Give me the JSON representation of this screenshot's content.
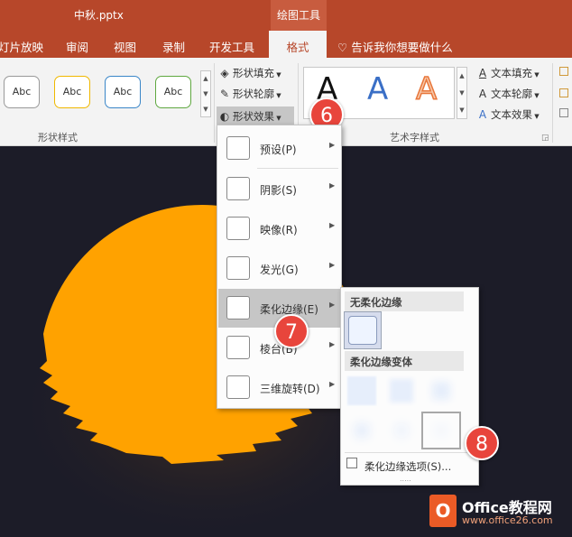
{
  "titlebar": {
    "file_title": "中秋.pptx",
    "context_tab": "绘图工具"
  },
  "tabs": {
    "slideshow": "灯片放映",
    "review": "审阅",
    "view": "视图",
    "record": "录制",
    "developer": "开发工具",
    "format": "格式",
    "tellme": "告诉我你想要做什么"
  },
  "ribbon": {
    "shape_styles": {
      "items": [
        "Abc",
        "Abc",
        "Abc",
        "Abc"
      ],
      "label": "形状样式"
    },
    "shape_cmds": {
      "fill": "形状填充",
      "outline": "形状轮廓",
      "effects": "形状效果"
    },
    "wordart": {
      "letters": [
        "A",
        "A",
        "A"
      ],
      "label": "艺术字样式"
    },
    "text_cmds": {
      "fill": "文本填充",
      "outline": "文本轮廓",
      "effects": "文本效果"
    }
  },
  "menu": {
    "items": [
      {
        "label": "预设(P)"
      },
      {
        "label": "阴影(S)"
      },
      {
        "label": "映像(R)"
      },
      {
        "label": "发光(G)"
      },
      {
        "label": "柔化边缘(E)"
      },
      {
        "label": "棱台(B)"
      },
      {
        "label": "三维旋转(D)"
      }
    ]
  },
  "submenu": {
    "no_soft_edge": "无柔化边缘",
    "variants": "柔化边缘变体",
    "options": "柔化边缘选项(S)...",
    "grip": "....."
  },
  "badges": [
    "6",
    "7",
    "8"
  ],
  "watermark": {
    "title": "Office教程网",
    "url": "www.office26.com"
  },
  "colors": {
    "accent": "#b7472a",
    "sun": "#ffa200",
    "badge": "#e8453c"
  }
}
